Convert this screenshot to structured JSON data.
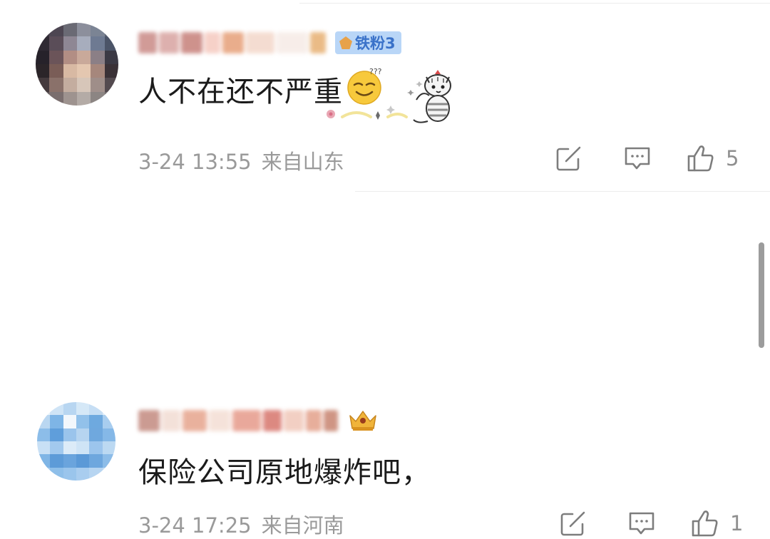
{
  "comments": [
    {
      "badge": "铁粉3",
      "text": "人不在还不严重",
      "emoji": "smirk-face-emoji",
      "sticker": "cat-sticker",
      "time": "3-24 13:55",
      "location": "来自山东",
      "likes": "5"
    },
    {
      "crown_badge": "crown-badge-icon",
      "text": "保险公司原地爆炸吧，",
      "time": "3-24 17:25",
      "location": "来自河南",
      "likes": "1"
    }
  ],
  "icons": {
    "repost": "repost-icon",
    "comment": "comment-icon",
    "like": "thumbs-up-icon"
  },
  "colors": {
    "meta_text": "#9a9a9a",
    "badge_bg": "#b9d6f7",
    "badge_text": "#3a72c9"
  }
}
